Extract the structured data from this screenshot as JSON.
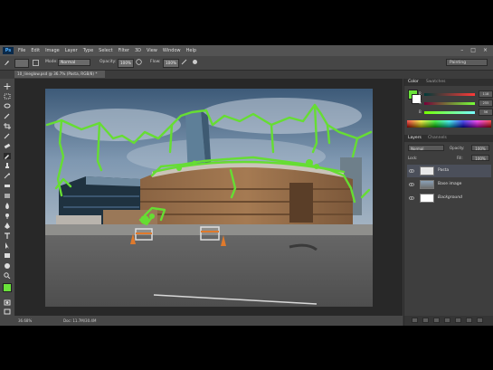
{
  "app": {
    "logo_text": "Ps"
  },
  "menu": {
    "items": [
      "File",
      "Edit",
      "Image",
      "Layer",
      "Type",
      "Select",
      "Filter",
      "3D",
      "View",
      "Window",
      "Help"
    ],
    "window_controls": [
      "–",
      "□",
      "×"
    ]
  },
  "options_bar": {
    "mode_label": "Mode:",
    "mode_value": "Normal",
    "opacity_label": "Opacity:",
    "opacity_value": "100%",
    "flow_label": "Flow:",
    "flow_value": "100%",
    "workspace": "Painting"
  },
  "document": {
    "tab_title": "10_lineglow.psd @ 36.7% (Pasta, RGB/8) *",
    "zoom": "36.68%",
    "doc_size": "Doc: 11.7M/30.4M"
  },
  "color_panel": {
    "tabs": [
      "Color",
      "Swatches"
    ],
    "sliders": [
      {
        "label": "R",
        "value": "118"
      },
      {
        "label": "G",
        "value": "255"
      },
      {
        "label": "B",
        "value": "56"
      }
    ],
    "foreground": "#6ae23a",
    "background": "#ffffff"
  },
  "layers_panel": {
    "tabs": [
      "Layers",
      "Channels"
    ],
    "blend_mode": "Normal",
    "opacity_label": "Opacity:",
    "opacity_value": "100%",
    "lock_label": "Lock:",
    "fill_label": "Fill:",
    "fill_value": "100%",
    "layers": [
      {
        "name": "Pasta",
        "selected": true
      },
      {
        "name": "Base image",
        "selected": false
      },
      {
        "name": "Background",
        "selected": false
      }
    ]
  },
  "colors": {
    "accent_green": "#66dd33",
    "panel_bg": "#3e3e3e",
    "toolbar_bg": "#474747"
  }
}
